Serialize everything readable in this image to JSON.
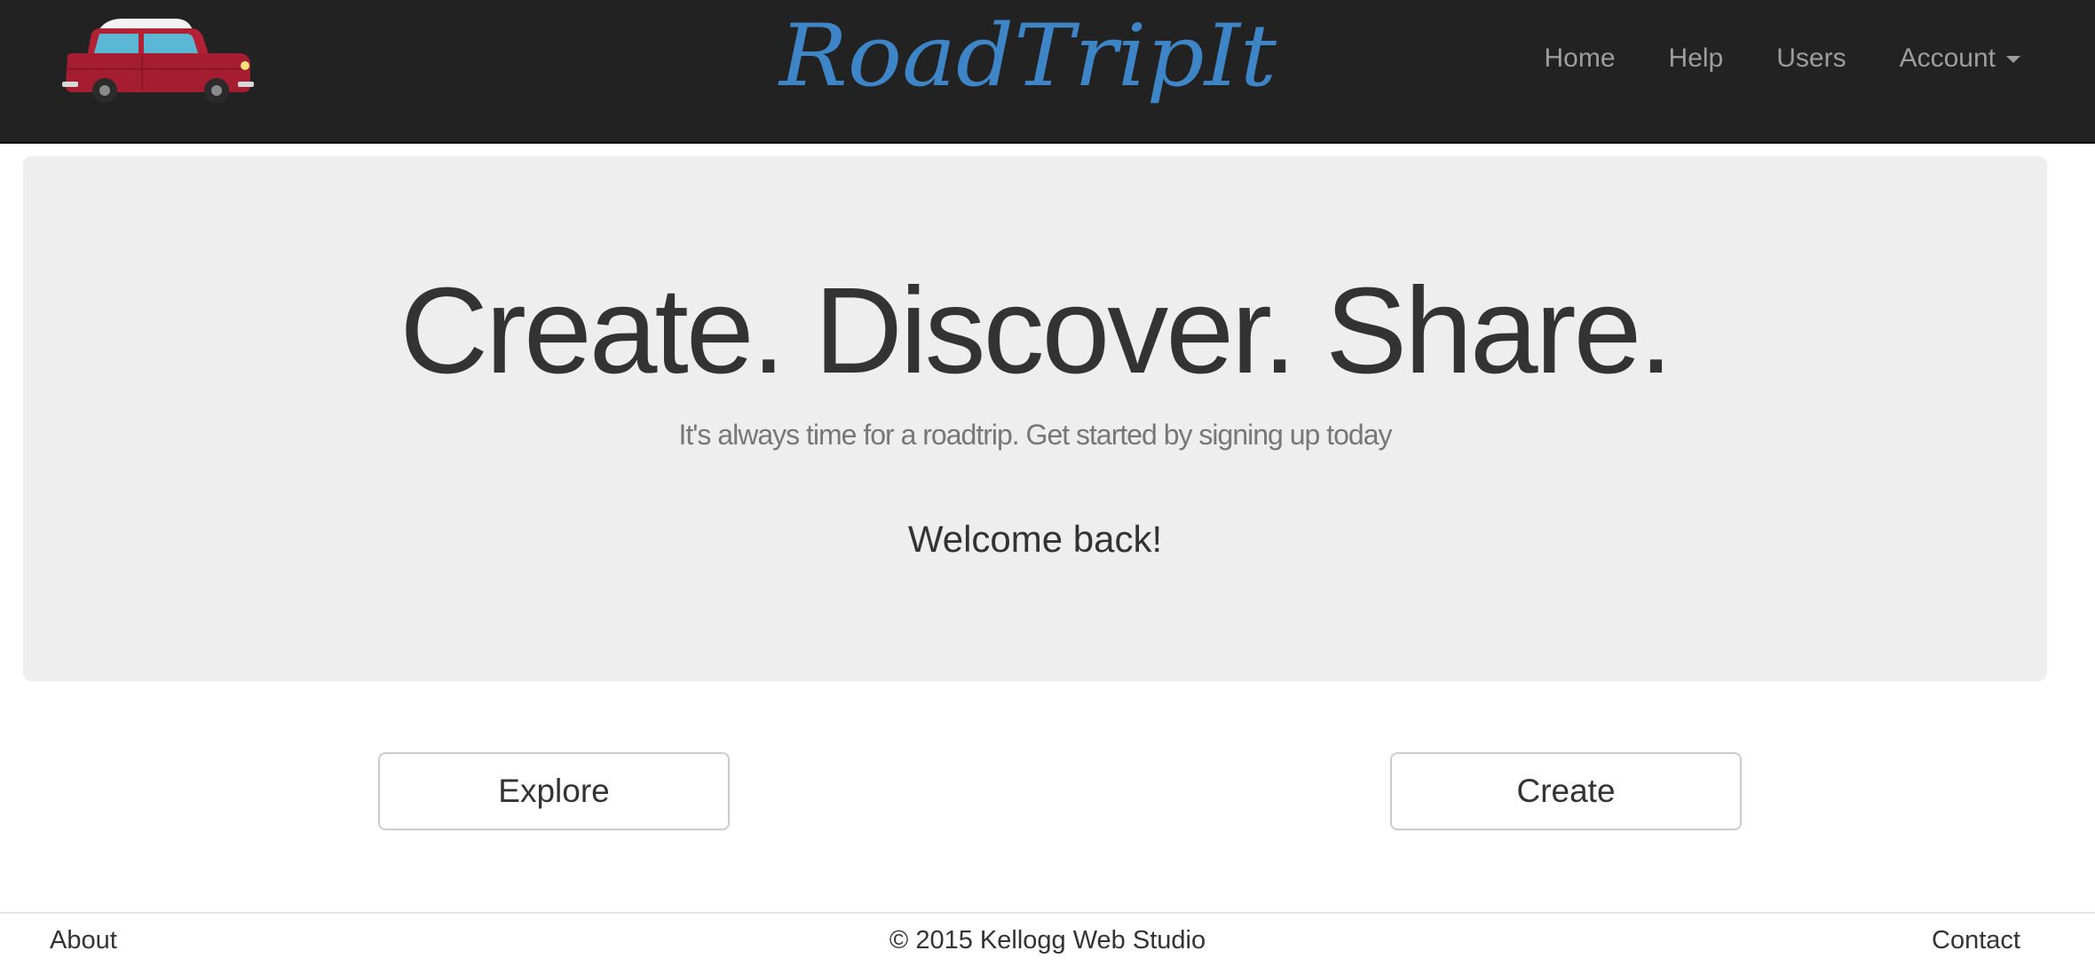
{
  "navbar": {
    "logo_icon": "red-mini-car-icon",
    "brand": "RoadTripIt",
    "links": [
      {
        "label": "Home"
      },
      {
        "label": "Help"
      },
      {
        "label": "Users"
      },
      {
        "label": "Account",
        "has_dropdown": true
      }
    ]
  },
  "hero": {
    "headline": "Create. Discover. Share.",
    "tagline": "It's always time for a roadtrip. Get started by signing up today",
    "welcome": "Welcome back!"
  },
  "actions": {
    "explore_label": "Explore",
    "create_label": "Create"
  },
  "footer": {
    "about": "About",
    "copyright": "© 2015 Kellogg Web Studio",
    "contact": "Contact"
  },
  "colors": {
    "navbar_bg": "#222222",
    "brand_blue": "#3d85c6",
    "nav_link": "#9d9d9d",
    "hero_bg": "#eeeeee",
    "car_red": "#b22234",
    "car_window": "#5bb8d4"
  }
}
